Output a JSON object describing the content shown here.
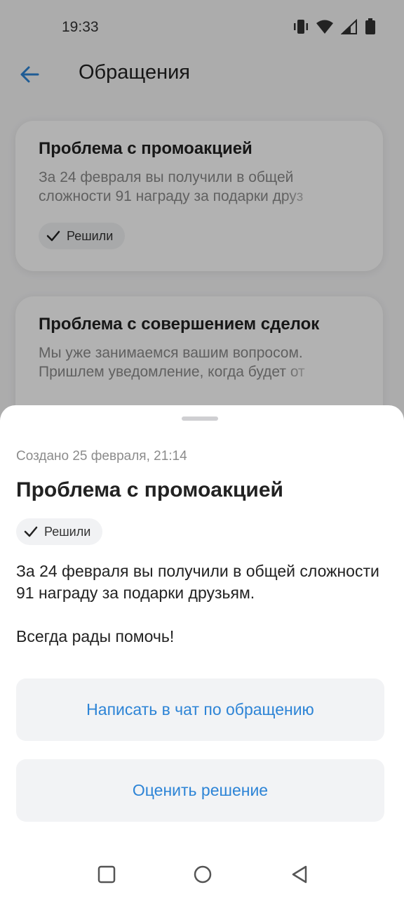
{
  "status_bar": {
    "time": "19:33",
    "icons": [
      "vibrate-icon",
      "wifi-icon",
      "signal-icon",
      "battery-icon"
    ]
  },
  "app_bar": {
    "title": "Обращения",
    "back_icon": "arrow-left-icon"
  },
  "tickets": [
    {
      "title": "Проблема с промоакцией",
      "preview_line1": "За 24 февраля вы получили в общей",
      "preview_line2": "сложности 91 награду за подарки друз",
      "status": "Решили"
    },
    {
      "title": "Проблема с совершением сделок",
      "preview_line1": "Мы уже занимаемся вашим вопросом.",
      "preview_line2": "Пришлем уведомление, когда будет от"
    }
  ],
  "sheet": {
    "created": "Создано 25 февраля, 21:14",
    "title": "Проблема с промоакцией",
    "status": "Решили",
    "body1": "За 24 февраля вы получили в общей сложности 91 награду за подарки друзьям.",
    "body2": "Всегда рады помочь!",
    "chat_button": "Написать в чат по обращению",
    "rate_button": "Оценить решение"
  },
  "nav": {
    "icons": [
      "recent-apps-icon",
      "home-icon",
      "back-triangle-icon"
    ]
  },
  "colors": {
    "accent": "#2d84d6",
    "chip_bg": "#f1f2f4",
    "button_bg": "#f2f3f5"
  }
}
